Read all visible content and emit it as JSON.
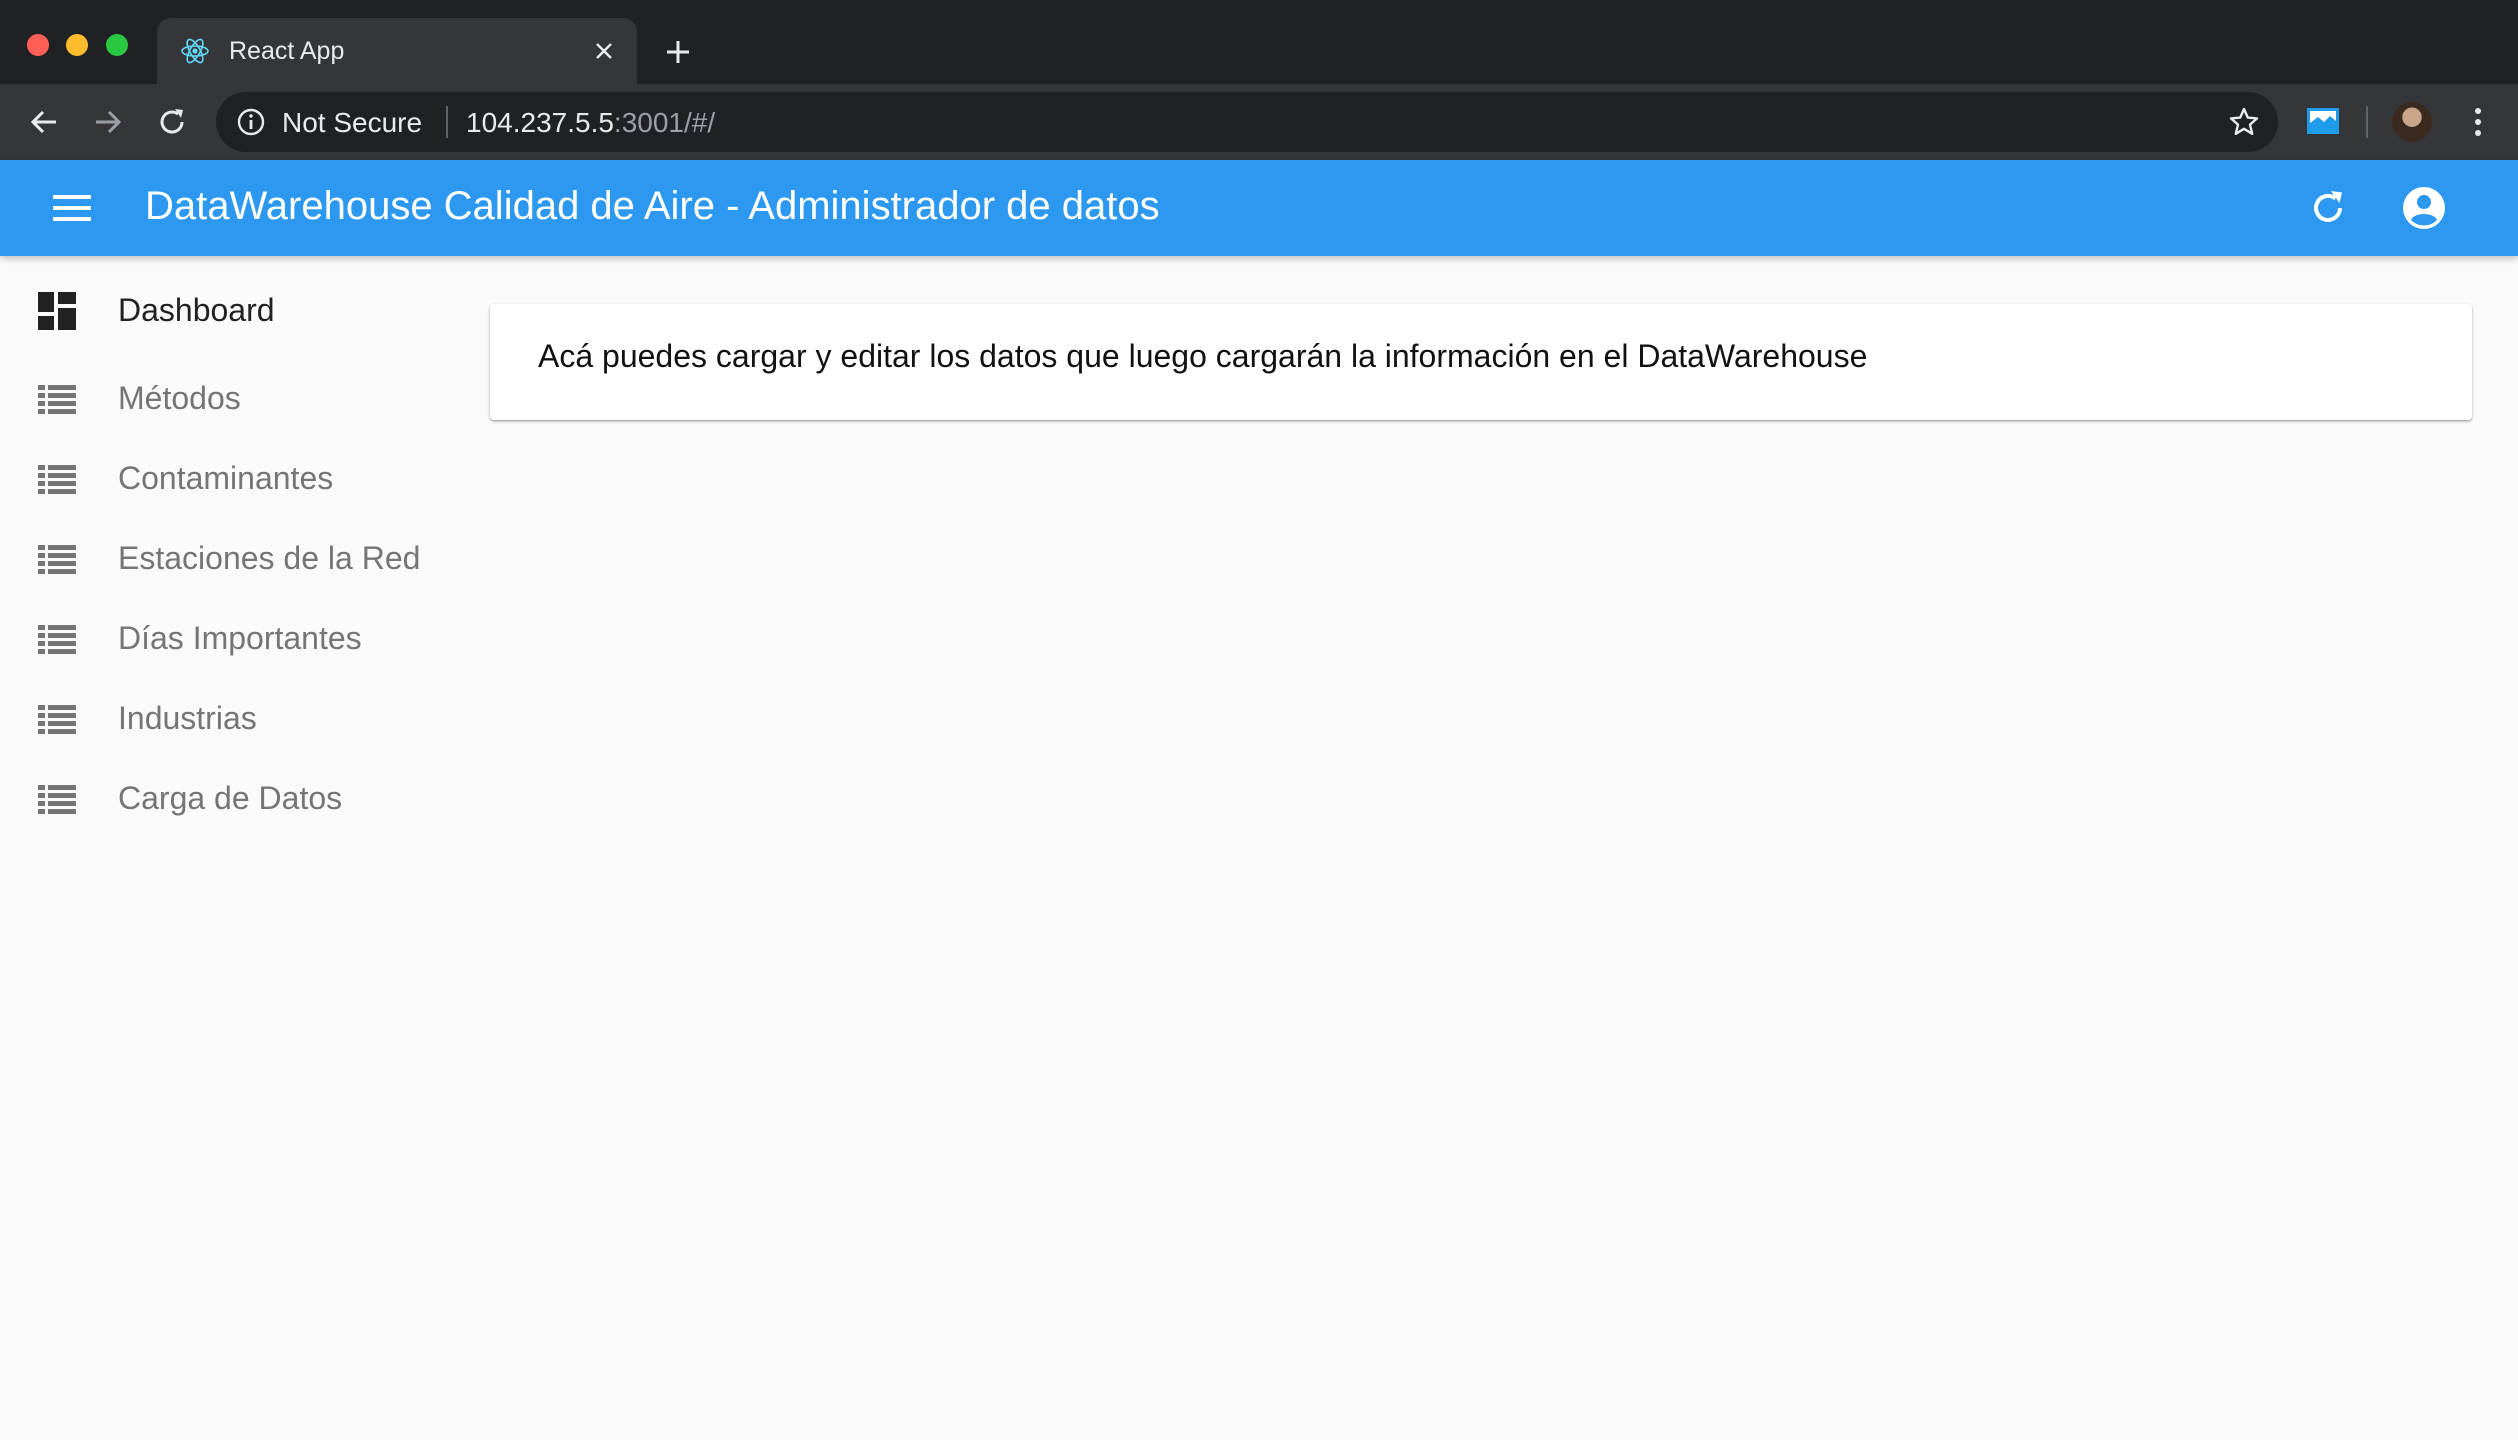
{
  "browser": {
    "tab_title": "React App",
    "security_label": "Not Secure",
    "url_host": "104.237.5.5",
    "url_rest": ":3001/#/"
  },
  "appbar": {
    "title": "DataWarehouse Calidad de Aire - Administrador de datos"
  },
  "sidebar": {
    "items": [
      {
        "label": "Dashboard",
        "icon": "dashboard-icon"
      },
      {
        "label": "Métodos",
        "icon": "list-icon"
      },
      {
        "label": "Contaminantes",
        "icon": "list-icon"
      },
      {
        "label": "Estaciones de la Red",
        "icon": "list-icon"
      },
      {
        "label": "Días Importantes",
        "icon": "list-icon"
      },
      {
        "label": "Industrias",
        "icon": "list-icon"
      },
      {
        "label": "Carga de Datos",
        "icon": "list-icon"
      }
    ]
  },
  "main": {
    "intro_text": "Acá puedes cargar y editar los datos que luego cargarán la información en el DataWarehouse"
  },
  "colors": {
    "appbar": "#2c98f0",
    "chrome_dark": "#202124",
    "chrome_toolbar": "#35363a",
    "background": "#fafafa"
  }
}
